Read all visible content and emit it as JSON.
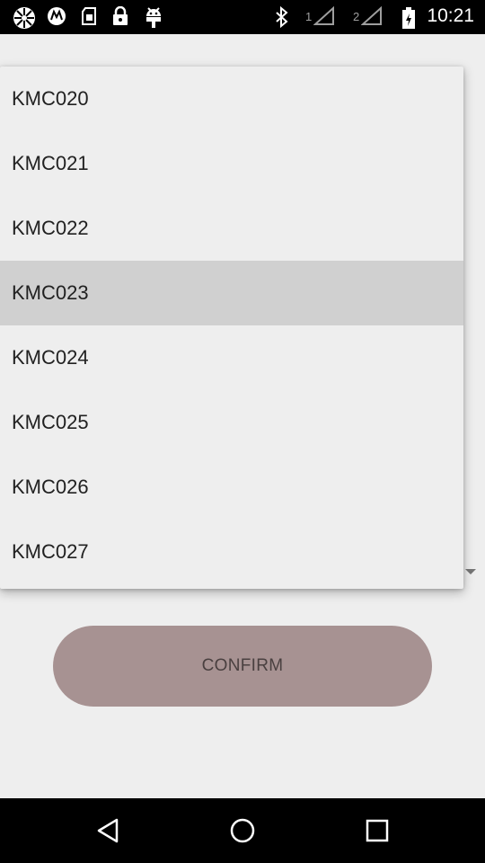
{
  "status_bar": {
    "time": "10:21",
    "sim1_label": "1",
    "sim2_label": "2",
    "icons": [
      "app-icon",
      "motorola-icon",
      "sim-card-icon",
      "lock-icon",
      "android-debug-icon",
      "bluetooth-icon",
      "signal-icon",
      "signal-icon",
      "battery-icon"
    ]
  },
  "dropdown": {
    "items": [
      {
        "label": "KMC020"
      },
      {
        "label": "KMC021"
      },
      {
        "label": "KMC022"
      },
      {
        "label": "KMC023"
      },
      {
        "label": "KMC024"
      },
      {
        "label": "KMC025"
      },
      {
        "label": "KMC026"
      },
      {
        "label": "KMC027"
      }
    ],
    "selected_value": "KMC023"
  },
  "confirm": {
    "label": "CONFIRM"
  },
  "nav": {
    "icons": [
      "back-icon",
      "home-icon",
      "recents-icon"
    ]
  },
  "colors": {
    "background": "#eeeeee",
    "selected_row": "#d0d0d0",
    "confirm_button": "#a79292"
  }
}
